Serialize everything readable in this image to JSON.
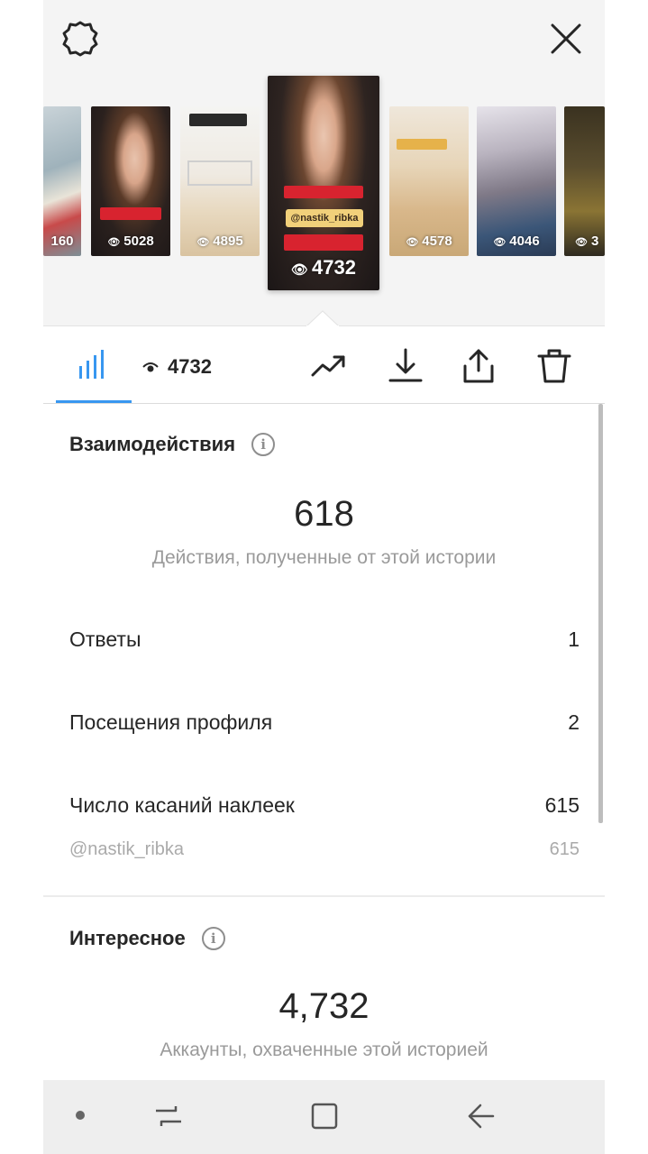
{
  "header": {
    "settings_icon": "gear-icon",
    "close_icon": "close-icon"
  },
  "stories": [
    {
      "views": "160"
    },
    {
      "views": "5028"
    },
    {
      "views": "4895"
    },
    {
      "views": "4732",
      "selected": true,
      "sticker": "@nastik_ribka"
    },
    {
      "views": "4578"
    },
    {
      "views": "4046"
    },
    {
      "views": "3"
    }
  ],
  "toolbar": {
    "view_count": "4732",
    "icons": [
      "bar-chart-icon",
      "eye-icon",
      "trending-up-icon",
      "download-icon",
      "share-icon",
      "trash-icon"
    ],
    "accent_color": "#3897f0"
  },
  "interactions": {
    "title": "Взаимодействия",
    "total": "618",
    "caption": "Действия, полученные от этой истории",
    "rows": [
      {
        "label": "Ответы",
        "value": "1"
      },
      {
        "label": "Посещения профиля",
        "value": "2"
      },
      {
        "label": "Число касаний наклеек",
        "value": "615"
      }
    ],
    "sticker_row": {
      "label": "@nastik_ribka",
      "value": "615"
    }
  },
  "discovery": {
    "title": "Интересное",
    "total": "4,732",
    "caption": "Аккаунты, охваченные этой историей"
  },
  "navbar": {
    "icons": [
      "recent-apps-icon",
      "home-icon",
      "back-icon"
    ]
  }
}
